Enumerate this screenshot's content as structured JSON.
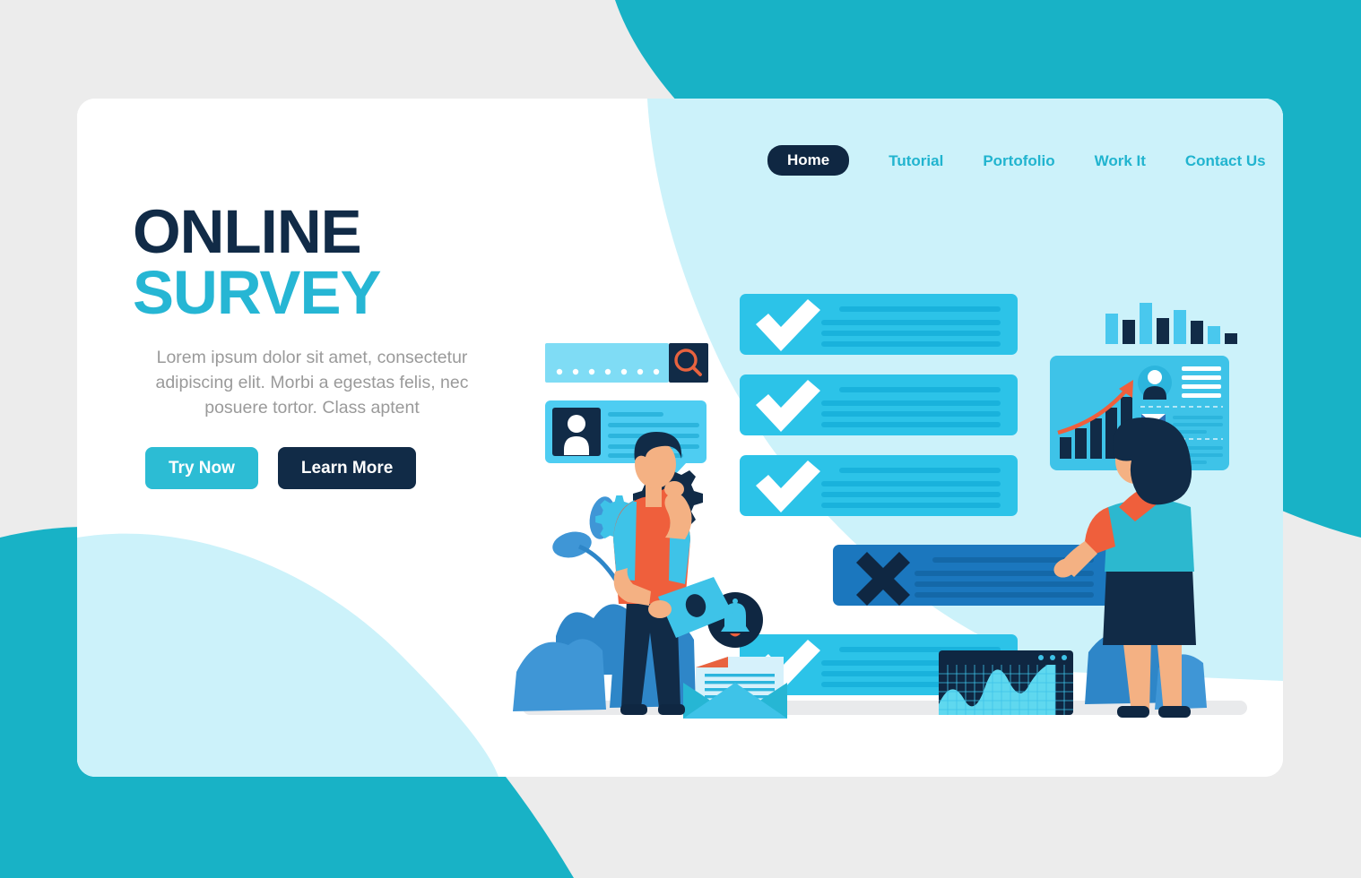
{
  "page": {
    "background_color": "#ececec",
    "card_color": "#ffffff",
    "teal_blob_color": "#18b2c6",
    "pale_cyan_color": "#ccf2fa"
  },
  "nav": {
    "active_item": "Home",
    "items": [
      {
        "label": "Home",
        "active": true
      },
      {
        "label": "Tutorial",
        "active": false
      },
      {
        "label": "Portofolio",
        "active": false
      },
      {
        "label": "Work It",
        "active": false
      },
      {
        "label": "Contact Us",
        "active": false
      }
    ],
    "active_bg": "#0f2742",
    "link_color": "#21b4cf"
  },
  "hero": {
    "title_line1": "ONLINE",
    "title_line2": "SURVEY",
    "title_line1_color": "#112b47",
    "title_line2_color": "#26b6d4",
    "paragraph": "Lorem ipsum dolor sit amet, consectetur adipiscing elit. Morbi a egestas felis, nec posuere tortor. Class aptent",
    "paragraph_color": "#9a9a9a",
    "buttons": [
      {
        "label": "Try Now",
        "style": "primary",
        "color": "#2cbcd4"
      },
      {
        "label": "Learn More",
        "style": "secondary",
        "color": "#112b47"
      }
    ]
  },
  "illustration": {
    "search_bar": {
      "dot_count": 7,
      "bar_color": "#7fdcf5",
      "icon_box_color": "#112b47",
      "icon_color": "#e8633f"
    },
    "chat_bubble": {
      "avatar_box_color": "#112b47",
      "bubble_color": "#4ecdf2",
      "line_count": 5
    },
    "gears": [
      {
        "name": "gear-large",
        "color": "#112b47",
        "center_color": "#ef5f3c"
      },
      {
        "name": "gear-small",
        "color": "#3ec3e8",
        "center_color": "#112b47"
      }
    ],
    "survey_cards": [
      {
        "type": "check",
        "color": "#2cc3e8",
        "mark_color": "#ffffff",
        "line_count": 4
      },
      {
        "type": "check",
        "color": "#2cc3e8",
        "mark_color": "#ffffff",
        "line_count": 4
      },
      {
        "type": "check",
        "color": "#2cc3e8",
        "mark_color": "#ffffff",
        "line_count": 4
      },
      {
        "type": "cross",
        "color": "#1b77be",
        "mark_color": "#0f2742",
        "line_count": 4
      },
      {
        "type": "check",
        "color": "#2cc3e8",
        "mark_color": "#ffffff",
        "line_count": 4
      }
    ],
    "notification_bell": {
      "circle_color": "#0f2742",
      "bell_color": "#3ec3e8",
      "clapper_color": "#ef5f3c"
    },
    "envelope": {
      "body_color": "#3ec3e8",
      "flap_color": "#2cc3e8",
      "document_color": "#d6f1fb",
      "corner_color": "#e8633f"
    },
    "male_character": {
      "shirt_color": "#ef5f3c",
      "sleeve_color": "#3ec3e8",
      "hair_color": "#112b47",
      "pants_color": "#112b47",
      "skin_color": "#f4b183",
      "laptop_color": "#3ec3e8"
    },
    "female_character": {
      "hair_color": "#112b47",
      "top_color": "#2cb8cf",
      "sleeve_color": "#ef5f3c",
      "skirt_color": "#112b47",
      "skin_color": "#f4b183",
      "shoe_color": "#0f2742"
    },
    "foliage_color": "#2e86c8",
    "ground_color": "#e9eaec"
  },
  "chart_data": [
    {
      "type": "bar",
      "name": "top-alternating-bar-chart",
      "title": "",
      "categories": [
        "1",
        "2",
        "3",
        "4",
        "5",
        "6",
        "7",
        "8"
      ],
      "values": [
        34,
        27,
        46,
        29,
        38,
        26,
        20,
        12
      ],
      "colors": [
        "#49c8ee",
        "#112b47",
        "#49c8ee",
        "#112b47",
        "#49c8ee",
        "#112b47",
        "#49c8ee",
        "#112b47"
      ],
      "xlabel": "",
      "ylabel": "",
      "ylim": [
        0,
        50
      ],
      "grid": false,
      "legend": "none"
    },
    {
      "type": "bar",
      "name": "dashboard-growth-bar-chart",
      "title": "",
      "categories": [
        "1",
        "2",
        "3",
        "4",
        "5"
      ],
      "values": [
        18,
        30,
        42,
        56,
        72
      ],
      "bar_color": "#112b47",
      "annotation": "upward-trend-arrow",
      "annotation_color": "#ef5f3c",
      "xlabel": "",
      "ylabel": "",
      "ylim": [
        0,
        80
      ],
      "grid": false,
      "legend": "none"
    },
    {
      "type": "area",
      "name": "window-wave-area-chart",
      "title": "",
      "x": [
        0,
        1,
        2,
        3,
        4,
        5,
        6,
        7,
        8,
        9,
        10
      ],
      "values": [
        28,
        48,
        30,
        22,
        55,
        68,
        46,
        24,
        18,
        38,
        62
      ],
      "area_color": "#5fd8ef",
      "background_color": "#0f2742",
      "grid": true,
      "legend": "none",
      "xlabel": "",
      "ylabel": "",
      "ylim": [
        0,
        80
      ]
    }
  ],
  "dashboard_bubble": {
    "bubble_color": "#3ec3e8",
    "avatar_color": "#112b47",
    "avatar_circle_color": "#2cb5dd",
    "text_line_count": 4,
    "email_rows": 2,
    "email_icon_color": "#2e6fb7"
  }
}
